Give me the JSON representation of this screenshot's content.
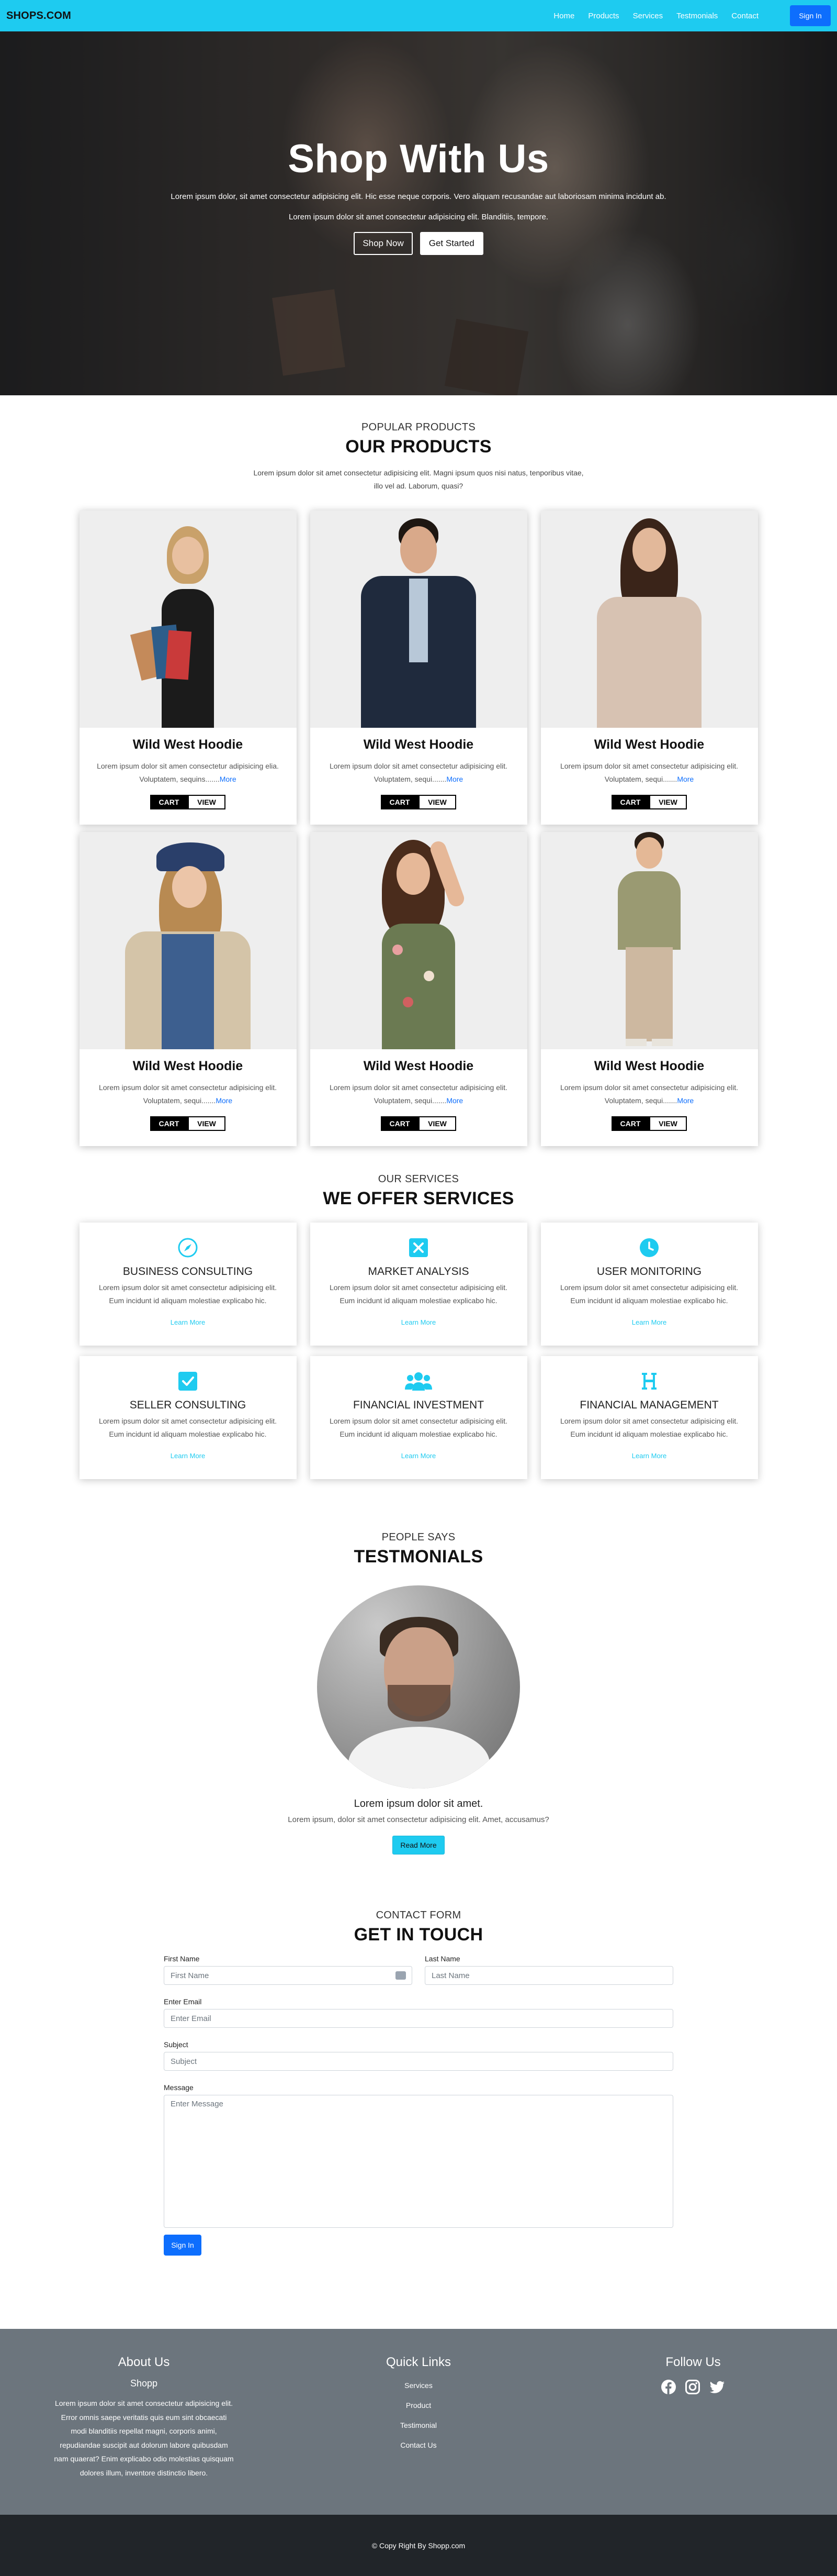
{
  "nav": {
    "brand": "SHOPS.COM",
    "links": [
      "Home",
      "Products",
      "Services",
      "Testmonials",
      "Contact"
    ],
    "signin": "Sign In"
  },
  "hero": {
    "title": "Shop With Us",
    "sub1": "Lorem ipsum dolor, sit amet consectetur adipisicing elit. Hic esse neque corporis. Vero aliquam recusandae aut laboriosam minima incidunt ab.",
    "sub2": "Lorem ipsum dolor sit amet consectetur adipisicing elit. Blanditiis, tempore.",
    "btn_shop": "Shop Now",
    "btn_start": "Get Started"
  },
  "products": {
    "kicker": "POPULAR PRODUCTS",
    "heading": "OUR PRODUCTS",
    "lead": "Lorem ipsum dolor sit amet consectetur adipisicing elit. Magni ipsum quos nisi natus, tenporibus vitae, illo vel ad. Laborum, quasi?",
    "items": [
      {
        "title": "Wild West Hoodie",
        "desc": "Lorem ipsum dolor sit amen consectetur adipisicing elia. Voluptatem, sequins.......",
        "more": "More",
        "cart": "CART",
        "view": "VIEW"
      },
      {
        "title": "Wild West Hoodie",
        "desc": "Lorem ipsum dolor sit amet consectetur adipisicing elit. Voluptatem, sequi.......",
        "more": "More",
        "cart": "CART",
        "view": "VIEW"
      },
      {
        "title": "Wild West Hoodie",
        "desc": "Lorem ipsum dolor sit amet consectetur adipisicing elit. Voluptatem, sequi.......",
        "more": "More",
        "cart": "CART",
        "view": "VIEW"
      },
      {
        "title": "Wild West Hoodie",
        "desc": "Lorem ipsum dolor sit amet consectetur adipisicing elit. Voluptatem, sequi.......",
        "more": "More",
        "cart": "CART",
        "view": "VIEW"
      },
      {
        "title": "Wild West Hoodie",
        "desc": "Lorem ipsum dolor sit amet consectetur adipisicing elit. Voluptatem, sequi.......",
        "more": "More",
        "cart": "CART",
        "view": "VIEW"
      },
      {
        "title": "Wild West Hoodie",
        "desc": "Lorem ipsum dolor sit amet consectetur adipisicing elit. Voluptatem, sequi.......",
        "more": "More",
        "cart": "CART",
        "view": "VIEW"
      }
    ]
  },
  "services": {
    "kicker": "OUR SERVICES",
    "heading": "WE OFFER SERVICES",
    "items": [
      {
        "icon": "compass-icon",
        "title": "BUSINESS CONSULTING",
        "desc1": "Lorem ipsum dolor sit amet consectetur adipisicing elit.",
        "desc2": "Eum incidunt id aliquam molestiae explicabo hic.",
        "link": "Learn More"
      },
      {
        "icon": "x-square-icon",
        "title": "MARKET ANALYSIS",
        "desc1": "Lorem ipsum dolor sit amet consectetur adipisicing elit.",
        "desc2": "Eum incidunt id aliquam molestiae explicabo hic.",
        "link": "Learn More"
      },
      {
        "icon": "clock-icon",
        "title": "USER MONITORING",
        "desc1": "Lorem ipsum dolor sit amet consectetur adipisicing elit.",
        "desc2": "Eum incidunt id aliquam molestiae explicabo hic.",
        "link": "Learn More"
      },
      {
        "icon": "check-square-icon",
        "title": "SELLER CONSULTING",
        "desc1": "Lorem ipsum dolor sit amet consectetur adipisicing elit.",
        "desc2": "Eum incidunt id aliquam molestiae explicabo hic.",
        "link": "Learn More"
      },
      {
        "icon": "users-icon",
        "title": "FINANCIAL INVESTMENT",
        "desc1": "Lorem ipsum dolor sit amet consectetur adipisicing elit.",
        "desc2": "Eum incidunt id aliquam molestiae explicabo hic.",
        "link": "Learn More"
      },
      {
        "icon": "h-letter-icon",
        "title": "FINANCIAL MANAGEMENT",
        "desc1": "Lorem ipsum dolor sit amet consectetur adipisicing elit.",
        "desc2": "Eum incidunt id aliquam molestiae explicabo hic.",
        "link": "Learn More"
      }
    ]
  },
  "testimonials": {
    "kicker": "PEOPLE SAYS",
    "heading": "TESTMONIALS",
    "name": "Lorem ipsum dolor sit amet.",
    "text": "Lorem ipsum, dolor sit amet consectetur adipisicing elit. Amet, accusamus?",
    "button": "Read More"
  },
  "contact": {
    "kicker": "CONTACT FORM",
    "heading": "GET IN TOUCH",
    "first_label": "First Name",
    "first_ph": "First Name",
    "last_label": "Last Name",
    "last_ph": "Last Name",
    "email_label": "Enter Email",
    "email_ph": "Enter Email",
    "subject_label": "Subject",
    "subject_ph": "Subject",
    "message_label": "Message",
    "message_ph": "Enter Message",
    "submit": "Sign In"
  },
  "footer": {
    "about_title": "About Us",
    "about_sub": "Shopp",
    "about_text": "Lorem ipsum dolor sit amet consectetur adipisicing elit. Error omnis saepe veritatis quis eum sint obcaecati modi blanditiis repellat magni, corporis animi, repudiandae suscipit aut dolorum labore quibusdam nam quaerat? Enim explicabo odio molestias quisquam dolores illum, inventore distinctio libero.",
    "links_title": "Quick Links",
    "links": [
      "Services",
      "Product",
      "Testimonial",
      "Contact Us"
    ],
    "follow_title": "Follow Us",
    "copyright": "© Copy Right By Shopp.com"
  },
  "colors": {
    "accent": "#1ecbf0",
    "primary": "#0d6efd",
    "footer": "#6c757d",
    "bottom": "#212529"
  }
}
